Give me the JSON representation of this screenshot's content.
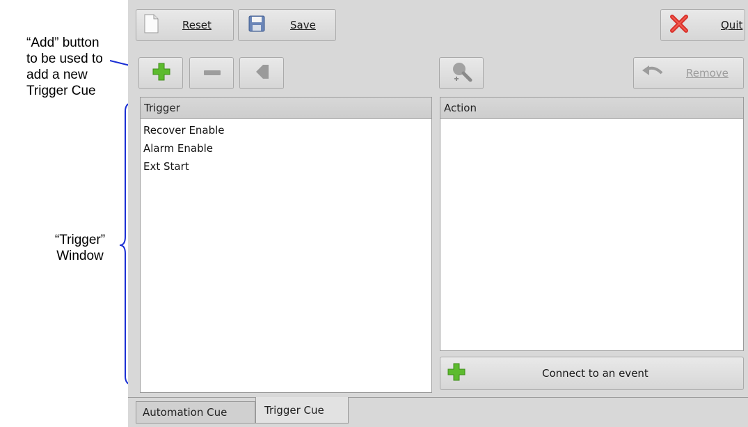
{
  "annotations": {
    "add_button_note": [
      "“Add” button",
      "to be used to",
      "add a new",
      "Trigger Cue"
    ],
    "trigger_window_note": [
      "“Trigger”",
      "Window"
    ]
  },
  "toolbar": {
    "reset_label": "Reset",
    "save_label": "Save",
    "quit_label": "Quit"
  },
  "secondary_toolbar": {
    "add_icon": "plus-icon",
    "remove_icon": "minus-icon",
    "edit_icon": "tag-icon",
    "search_icon": "search-icon",
    "remove_label": "Remove"
  },
  "trigger_pane": {
    "header": "Trigger",
    "items": [
      "Recover Enable",
      "Alarm Enable",
      "Ext Start"
    ]
  },
  "action_pane": {
    "header": "Action",
    "items": []
  },
  "connect_button_label": "Connect to an event",
  "tabs": [
    {
      "label": "Automation Cue",
      "active": false
    },
    {
      "label": "Trigger Cue",
      "active": true
    }
  ],
  "colors": {
    "annotation_blue": "#1a2fd4",
    "plus_green": "#5dbb2e",
    "quit_red": "#d9302a"
  }
}
